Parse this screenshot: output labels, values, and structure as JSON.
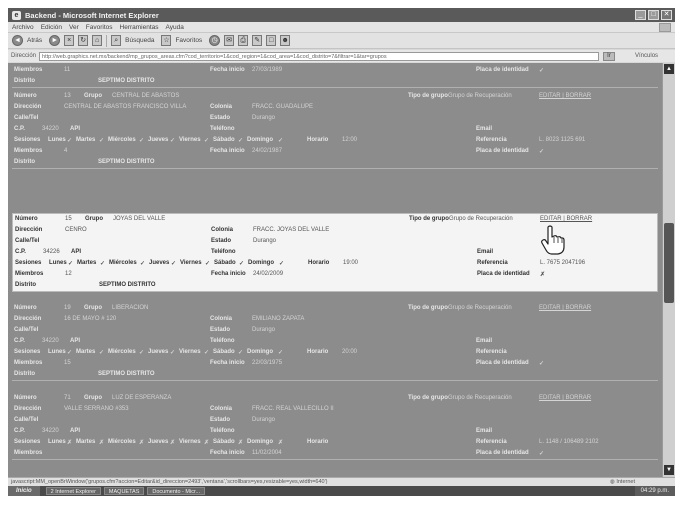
{
  "window": {
    "title": "Backend - Microsoft Internet Explorer"
  },
  "menu": [
    "Archivo",
    "Edición",
    "Ver",
    "Favoritos",
    "Herramientas",
    "Ayuda"
  ],
  "toolbar": {
    "back_label": "Atrás",
    "search_label": "Búsqueda",
    "favorites_label": "Favoritos"
  },
  "address": {
    "label": "Dirección",
    "url": "http://web.graphics.net.mx/backend/mp_grupos_areas.cfm?cod_territorio=1&cod_region=1&cod_area=1&cod_distrito=7&filtrar=1&tar=grupos",
    "go_label": "Ir",
    "links_label": "Vínculos"
  },
  "labels": {
    "numero": "Número",
    "grupo": "Grupo",
    "direccion": "Dirección",
    "colonia": "Colonia",
    "cp": "C.P.",
    "api": "API",
    "calle": "Calle/Tel",
    "estado": "Estado",
    "telefono": "Teléfono",
    "sesiones": "Sesiones",
    "horario": "Horario",
    "email": "Email",
    "referencia": "Referencia",
    "miembros": "Miembros",
    "fecha_inicio": "Fecha inicio",
    "placa": "Placa de identidad",
    "distrito": "Distrito",
    "tipo_grupo": "Tipo de grupo",
    "lunes": "Lunes",
    "martes": "Martes",
    "miercoles": "Miércoles",
    "jueves": "Jueves",
    "viernes": "Viernes",
    "sabado": "Sábado",
    "domingo": "Domingo"
  },
  "records": [
    {
      "numero": "",
      "grupo": "",
      "direccion": "",
      "colonia": "",
      "cp": "",
      "estado": "",
      "horario": "",
      "miembros": "11",
      "fecha_inicio": "27/03/1989",
      "distrito": "SEPTIMO DISTRITO",
      "tipo_grupo": "",
      "referencia": "",
      "days": "",
      "placa": "✓",
      "action": ""
    },
    {
      "numero": "13",
      "grupo": "CENTRAL DE ABASTOS",
      "direccion": "CENTRAL DE ABASTOS FRANCISCO VILLA",
      "colonia": "FRACC. GUADALUPE",
      "cp": "34220",
      "estado": "Durango",
      "horario": "12:00",
      "miembros": "4",
      "fecha_inicio": "24/02/1987",
      "distrito": "SEPTIMO DISTRITO",
      "tipo_grupo": "Grupo de Recuperación",
      "referencia": "L. 8023 1125 691",
      "days": "✓",
      "placa": "✓",
      "action": "EDITAR | BORRAR"
    },
    {
      "numero": "15",
      "grupo": "JOYAS DEL VALLE",
      "direccion": "CENRO",
      "colonia": "FRACC. JOYAS DEL VALLE",
      "cp": "34226",
      "estado": "Durango",
      "horario": "19:00",
      "miembros": "12",
      "fecha_inicio": "24/02/2009",
      "distrito": "SEPTIMO DISTRITO",
      "tipo_grupo": "Grupo de Recuperación",
      "referencia": "L. 7675 2047196",
      "days": "✓",
      "placa": "✗",
      "action": "EDITAR | BORRAR"
    },
    {
      "numero": "19",
      "grupo": "LIBERACION",
      "direccion": "16 DE MAYO # 120",
      "colonia": "EMILIANO ZAPATA",
      "cp": "34220",
      "estado": "Durango",
      "horario": "20:00",
      "miembros": "15",
      "fecha_inicio": "22/03/1975",
      "distrito": "SEPTIMO DISTRITO",
      "tipo_grupo": "Grupo de Recuperación",
      "referencia": "",
      "days": "✓",
      "placa": "✓",
      "action": "EDITAR | BORRAR"
    },
    {
      "numero": "71",
      "grupo": "LUZ DE ESPERANZA",
      "direccion": "VALLE SERRANO #353",
      "colonia": "FRACC. REAL VALLECILLO II",
      "cp": "34220",
      "estado": "Durango",
      "horario": "",
      "miembros": "",
      "fecha_inicio": "11/02/2004",
      "distrito": "",
      "tipo_grupo": "Grupo de Recuperación",
      "referencia": "L. 1148 / 106489 2102",
      "days": "✗",
      "placa": "✓",
      "action": "EDITAR | BORRAR"
    }
  ],
  "status": {
    "text": "javascript:MM_openBrWindow('grupos.cfm?accion=Editar&id_direccion=2493','ventana','scrollbars=yes,resizable=yes,width=640')",
    "zone": "Internet"
  },
  "taskbar": {
    "start": "Inicio",
    "tasks": [
      "2 Internet Explorer",
      "MAQUETAS",
      "Documento - Micr..."
    ],
    "clock": "04:29 p.m."
  }
}
